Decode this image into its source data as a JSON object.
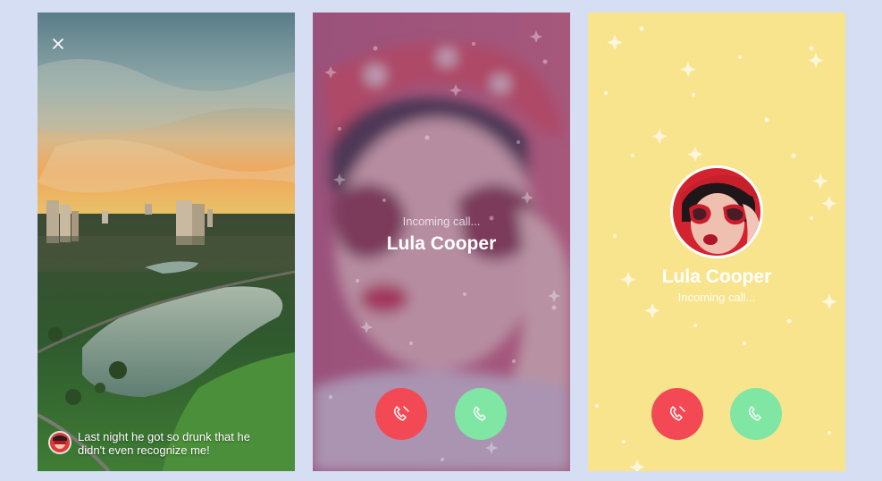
{
  "story": {
    "caption": "Last night he got so drunk that he didn't even recognize me!",
    "close_icon": "close-icon",
    "avatar_icon": "avatar"
  },
  "call_blurred": {
    "status": "Incoming call...",
    "caller_name": "Lula Cooper",
    "decline_icon": "phone-hangup-icon",
    "accept_icon": "phone-icon"
  },
  "call_yellow": {
    "caller_name": "Lula Cooper",
    "status": "Incoming call...",
    "decline_icon": "phone-hangup-icon",
    "accept_icon": "phone-icon"
  },
  "colors": {
    "page_bg": "#d5def2",
    "decline": "#f24955",
    "accept": "#7fe6a4",
    "yellow_bg": "#f9e48e",
    "blur_overlay": "#8e5d84"
  }
}
